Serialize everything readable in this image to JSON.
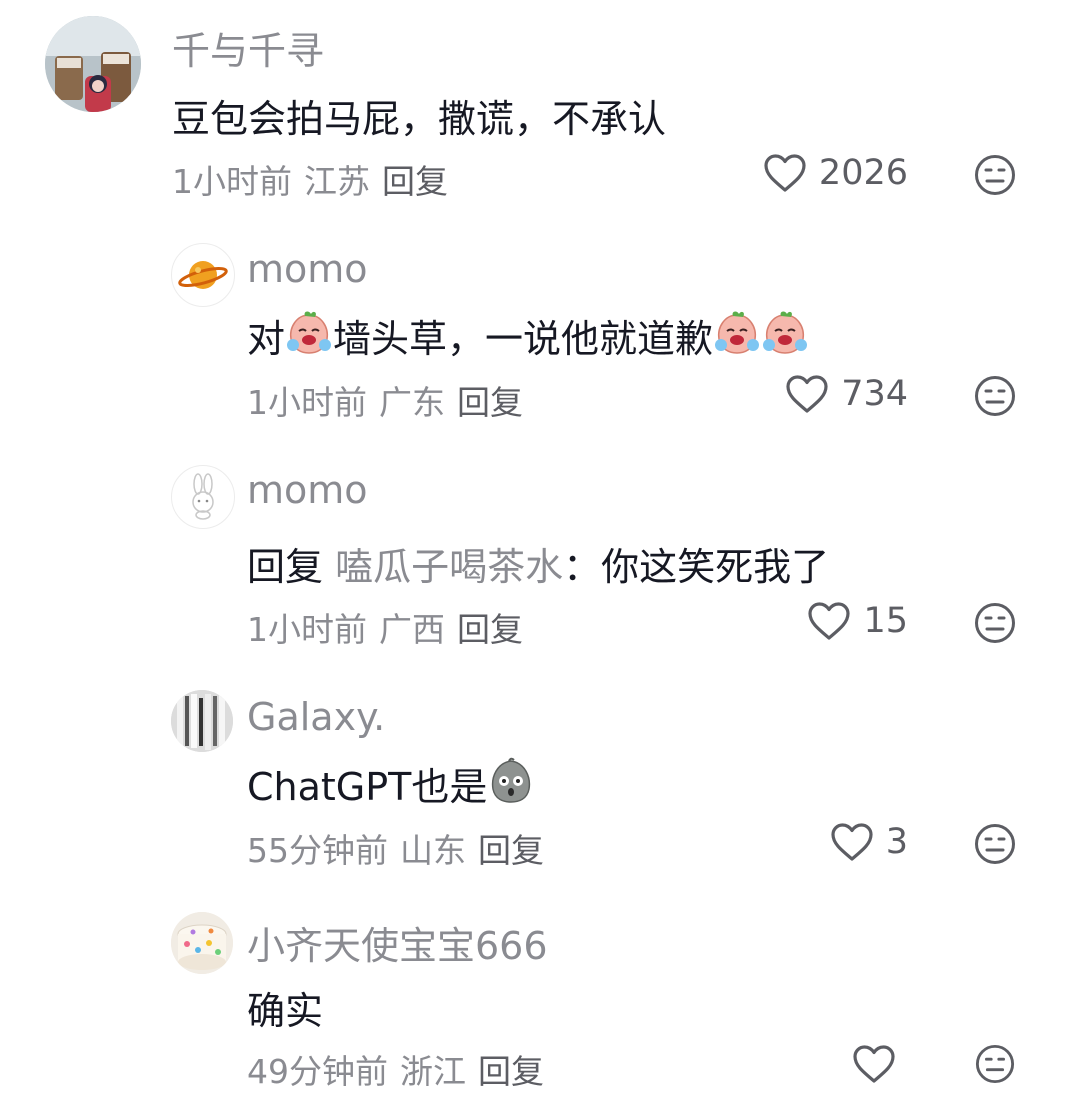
{
  "comments": [
    {
      "username": "千与千寻",
      "segments": [
        {
          "text": "豆包会拍马屁，撒谎，不承认"
        }
      ],
      "time": "1小时前",
      "location": "江苏",
      "reply_label": "回复",
      "likes": "2026",
      "avatar": "photo-avatar"
    },
    {
      "username": "momo",
      "segments": [
        {
          "text": "对"
        },
        {
          "emoji": "crying-peach"
        },
        {
          "text": "墙头草，一说他就道歉"
        },
        {
          "emoji": "crying-peach"
        },
        {
          "emoji": "crying-peach"
        }
      ],
      "time": "1小时前",
      "location": "广东",
      "reply_label": "回复",
      "likes": "734",
      "avatar": "planet-avatar"
    },
    {
      "username": "momo",
      "reply_prefix": "回复",
      "reply_to": "嗑瓜子喝茶水",
      "segments": [
        {
          "text": "：你这笑死我了"
        }
      ],
      "time": "1小时前",
      "location": "广西",
      "reply_label": "回复",
      "likes": "15",
      "avatar": "bunny-avatar"
    },
    {
      "username": "Galaxy.",
      "segments": [
        {
          "text": "ChatGPT也是"
        },
        {
          "emoji": "shocked-gray"
        }
      ],
      "time": "55分钟前",
      "location": "山东",
      "reply_label": "回复",
      "likes": "3",
      "avatar": "grayscale-avatar"
    },
    {
      "username": "小齐天使宝宝666",
      "segments": [
        {
          "text": "确实"
        }
      ],
      "time": "49分钟前",
      "location": "浙江",
      "reply_label": "回复",
      "likes": "",
      "avatar": "colorful-avatar"
    }
  ],
  "colors": {
    "username": "#8a8b91",
    "text": "#161823",
    "meta": "#8a8b91",
    "icon": "#5c5d63"
  }
}
